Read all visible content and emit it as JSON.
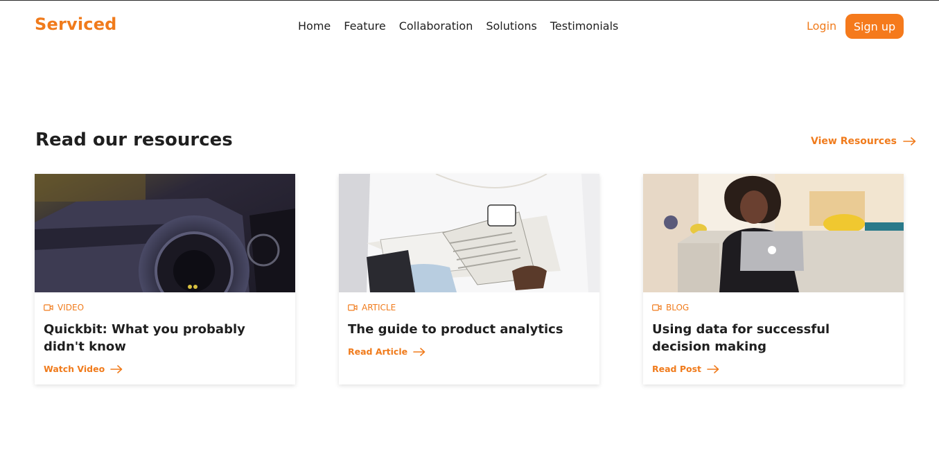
{
  "header": {
    "logo": "Serviced",
    "nav": [
      "Home",
      "Feature",
      "Collaboration",
      "Solutions",
      "Testimonials"
    ],
    "login": "Login",
    "signup": "Sign up"
  },
  "section": {
    "title": "Read our resources",
    "view_link": "View Resources"
  },
  "cards": [
    {
      "category": "VIDEO",
      "title": "Quickbit: What you probably didn't know",
      "cta": "Watch Video",
      "image": "camera-lens-photo",
      "category_icon": "video-icon"
    },
    {
      "category": "ARTICLE",
      "title": "The guide to product analytics",
      "cta": "Read Article",
      "image": "person-reading-newspaper-photo",
      "category_icon": "video-icon"
    },
    {
      "category": "BLOG",
      "title": "Using data for successful decision making",
      "cta": "Read Post",
      "image": "woman-with-laptop-photo",
      "category_icon": "video-icon"
    }
  ],
  "colors": {
    "accent": "#f07b1c",
    "text": "#1f1f1f"
  }
}
